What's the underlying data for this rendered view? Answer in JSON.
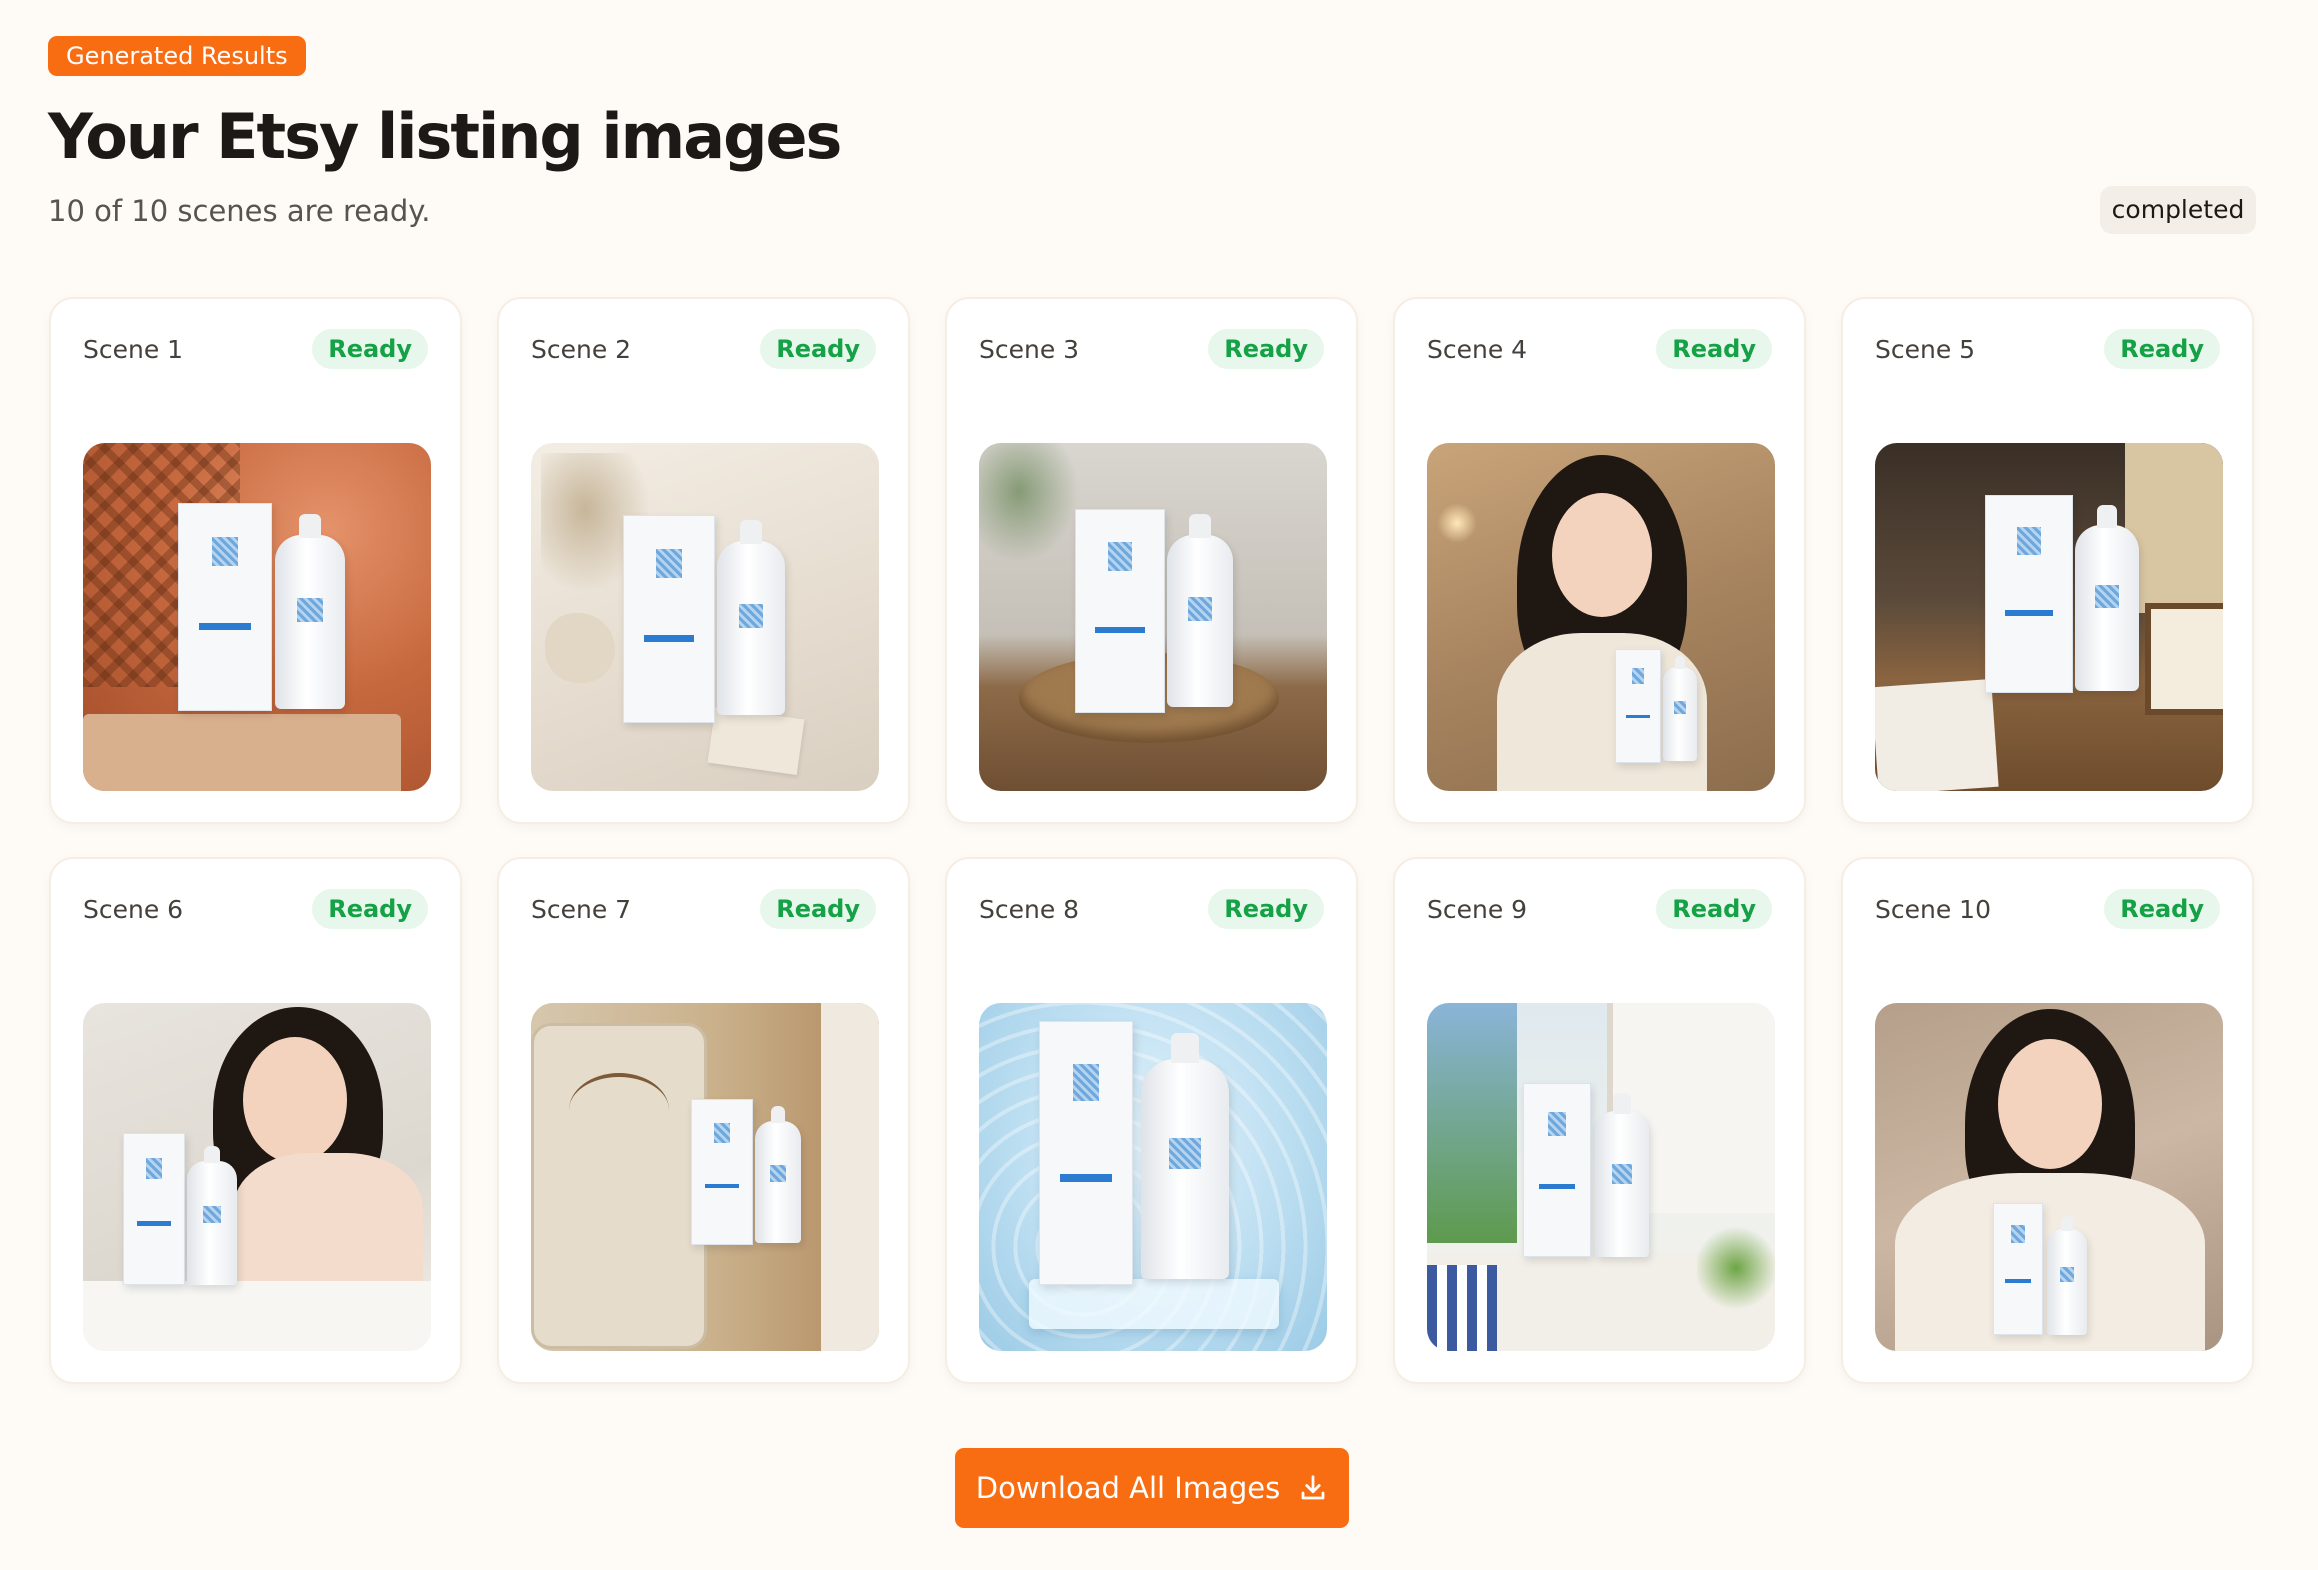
{
  "header": {
    "badge": "Generated Results",
    "title": "Your Etsy listing images",
    "subtitle": "10 of 10 scenes are ready.",
    "status": "completed"
  },
  "scenes": [
    {
      "label": "Scene 1",
      "status": "Ready"
    },
    {
      "label": "Scene 2",
      "status": "Ready"
    },
    {
      "label": "Scene 3",
      "status": "Ready"
    },
    {
      "label": "Scene 4",
      "status": "Ready"
    },
    {
      "label": "Scene 5",
      "status": "Ready"
    },
    {
      "label": "Scene 6",
      "status": "Ready"
    },
    {
      "label": "Scene 7",
      "status": "Ready"
    },
    {
      "label": "Scene 8",
      "status": "Ready"
    },
    {
      "label": "Scene 9",
      "status": "Ready"
    },
    {
      "label": "Scene 10",
      "status": "Ready"
    }
  ],
  "actions": {
    "download_all": "Download All Images",
    "download_icon": "download-icon"
  },
  "colors": {
    "accent": "#f96d12",
    "ready_text": "#15a146",
    "ready_bg": "#e7f7ec",
    "page_bg": "#fefbf7"
  }
}
